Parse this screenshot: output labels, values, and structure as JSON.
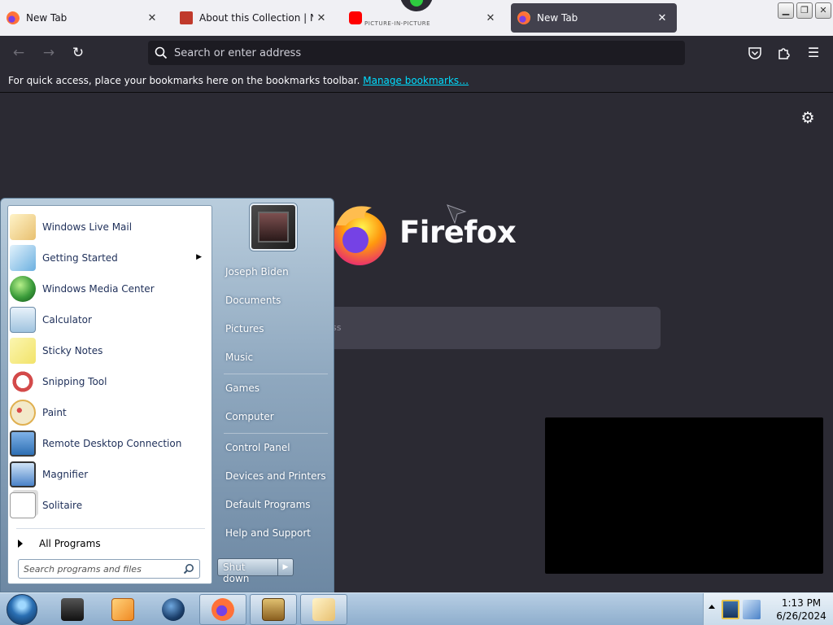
{
  "browser": {
    "tabs": [
      {
        "title": "New Tab",
        "favicon": "firefox-icon",
        "active": false
      },
      {
        "title": "About this Collection | New",
        "favicon": "archive-icon",
        "active": false
      },
      {
        "title": "",
        "favicon": "youtube-icon",
        "active": false
      },
      {
        "title": "New Tab",
        "favicon": "firefox-icon",
        "active": true
      }
    ],
    "pip_label": "PICTURE-IN-PICTURE",
    "address_bar": {
      "placeholder": "Search or enter address",
      "value": ""
    },
    "bookmarks_bar": {
      "message": "For quick access, place your bookmarks here on the bookmarks toolbar.",
      "link": "Manage bookmarks…"
    },
    "newtab": {
      "wordmark": "Firefox",
      "search_placeholder_fragment": "ss"
    },
    "colors": {
      "toolbar": "#2b2a33",
      "link": "#00ddff",
      "active_tab": "#42414d"
    }
  },
  "start_menu": {
    "programs": [
      {
        "label": "Windows Live Mail",
        "icon": "mail-icon",
        "color": "#e8c070"
      },
      {
        "label": "Getting Started",
        "icon": "getting-started-icon",
        "color": "#6cb0e0",
        "submenu": true
      },
      {
        "label": "Windows Media Center",
        "icon": "windows-logo-icon",
        "color": "#3a9b3a"
      },
      {
        "label": "Calculator",
        "icon": "calculator-icon",
        "color": "#9fc3df"
      },
      {
        "label": "Sticky Notes",
        "icon": "sticky-notes-icon",
        "color": "#f2e36a"
      },
      {
        "label": "Snipping Tool",
        "icon": "scissors-icon",
        "color": "#d34a4a"
      },
      {
        "label": "Paint",
        "icon": "paint-palette-icon",
        "color": "#e0b050"
      },
      {
        "label": "Remote Desktop Connection",
        "icon": "remote-desktop-icon",
        "color": "#2e6fb3"
      },
      {
        "label": "Magnifier",
        "icon": "magnifier-icon",
        "color": "#4a82c8"
      },
      {
        "label": "Solitaire",
        "icon": "cards-icon",
        "color": "#eeeeee"
      }
    ],
    "all_programs": "All Programs",
    "search_placeholder": "Search programs and files",
    "user_name": "Joseph Biden",
    "places": [
      "Documents",
      "Pictures",
      "Music",
      "Games",
      "Computer",
      "Control Panel",
      "Devices and Printers",
      "Default Programs",
      "Help and Support"
    ],
    "shutdown_label": "Shut down"
  },
  "taskbar": {
    "pinned": [
      {
        "name": "explorer",
        "icon": "folder-dark-icon",
        "color": "#2a2a2a"
      },
      {
        "name": "media-player",
        "icon": "media-player-icon",
        "color": "#f08a24"
      },
      {
        "name": "browser-globe",
        "icon": "globe-icon",
        "color": "#1b3f6b"
      },
      {
        "name": "firefox",
        "icon": "firefox-icon",
        "color": "#ff7139"
      },
      {
        "name": "game",
        "icon": "game-box-icon",
        "color": "#b08a3a"
      },
      {
        "name": "mail",
        "icon": "mail-icon",
        "color": "#e8c070"
      }
    ],
    "clock": {
      "time": "1:13 PM",
      "date": "6/26/2024"
    }
  }
}
